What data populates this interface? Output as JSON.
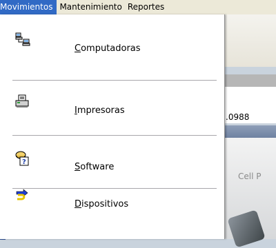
{
  "menubar": {
    "items": [
      {
        "label": "Movimientos",
        "active": true
      },
      {
        "label": "Mantenimiento",
        "active": false
      },
      {
        "label": "Reportes",
        "active": false
      }
    ]
  },
  "dropdown": {
    "items": [
      {
        "mnemonic": "C",
        "rest": "omputadoras",
        "icon": "computers-network-icon"
      },
      {
        "mnemonic": "I",
        "rest": "mpresoras",
        "icon": "printer-icon"
      },
      {
        "mnemonic": "S",
        "rest": "oftware",
        "icon": "software-help-icon"
      },
      {
        "mnemonic": "D",
        "rest": "ispositivos",
        "icon": "device-plug-icon"
      }
    ]
  },
  "background": {
    "grid_value": ".0988",
    "cell_text": "Cell P"
  },
  "colors": {
    "menu_highlight": "#316ac5",
    "menubar_bg": "#ece9d8"
  }
}
